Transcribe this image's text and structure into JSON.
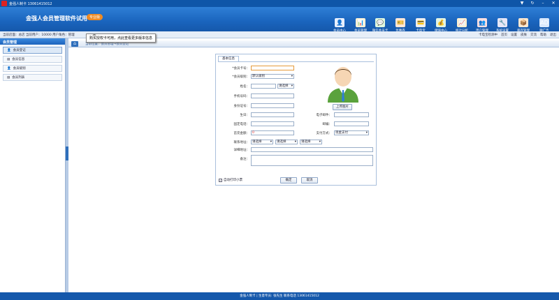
{
  "titlebar": {
    "title": "金强人制卡 13061415012"
  },
  "header": {
    "app_title": "金强人会员管理软件试用",
    "badge": "专业版",
    "tooltip": "购买授权卡可用，点此查看更多版本信息",
    "nav": [
      {
        "label": "会员中心",
        "icon": "member-center-icon",
        "glyph": "👤",
        "color": "#e8f0ff"
      },
      {
        "label": "会员管理",
        "icon": "member-manage-icon",
        "glyph": "📊",
        "color": "#fff3d6"
      },
      {
        "label": "微信会员卡",
        "icon": "wechat-icon",
        "glyph": "💬",
        "color": "#dff6df"
      },
      {
        "label": "优惠券",
        "icon": "coupon-icon",
        "glyph": "🎫",
        "color": "#ffe7d6"
      },
      {
        "label": "卡电宝",
        "icon": "card-device-icon",
        "glyph": "💳",
        "color": "#eee"
      },
      {
        "label": "储值中心",
        "icon": "stored-value-icon",
        "glyph": "💰",
        "color": "#e3f4e3"
      },
      {
        "label": "统计分析",
        "icon": "statistics-icon",
        "glyph": "📈",
        "color": "#fff0d0"
      },
      {
        "label": "用户管理",
        "icon": "user-manage-icon",
        "glyph": "👥",
        "color": "#fde0e0"
      },
      {
        "label": "系统设置",
        "icon": "settings-icon",
        "glyph": "🔧",
        "color": "#e6e6f6"
      },
      {
        "label": "库存管理",
        "icon": "inventory-icon",
        "glyph": "📦",
        "color": "#fde7d0"
      },
      {
        "label": "聊广告",
        "icon": "ad-icon",
        "glyph": "AD",
        "color": "#dbe9fb"
      }
    ]
  },
  "infobar": {
    "left": "当前店面：总店 当前用户：10000 用户角色：管理",
    "right": [
      "卡电宝检测中",
      "首页",
      "设置",
      "皮肤",
      "交流",
      "帮助",
      "退出"
    ]
  },
  "sidebar": {
    "header": "会员管理",
    "items": [
      {
        "label": "会员登记",
        "icon": "member-register-icon"
      },
      {
        "label": "会员信息",
        "icon": "member-info-icon"
      },
      {
        "label": "会员级别",
        "icon": "member-level-icon"
      },
      {
        "label": "会员列表",
        "icon": "member-list-icon"
      }
    ]
  },
  "crumb": {
    "text": "当前位置：会员管理→会员登记"
  },
  "form": {
    "tab": "基本信息",
    "labels": {
      "card_no": "*会员卡号：",
      "level": "*会员级别：",
      "name": "姓名：",
      "phone": "手机号码：",
      "idcard": "身份证号：",
      "birthday": "生日：",
      "email": "电子邮件：",
      "landline": "固定电话：",
      "zip": "邮编：",
      "amount": "首充金额：",
      "pay": "支付方式：",
      "address": "联系地址：",
      "detail_address": "详细地址：",
      "remark": "备注："
    },
    "level_value": "默认级别",
    "gender_value": "请选择",
    "amount_value": "0",
    "pay_value": "现金支付",
    "region": [
      "请选择",
      "请选择",
      "请选择"
    ],
    "upload": "上传图片",
    "print_check": "自动打印小票",
    "ok": "确定",
    "cancel": "取消"
  },
  "footer": {
    "text": "金强人制卡 | 生意专员: 张先生 联系电话 13061415012"
  }
}
